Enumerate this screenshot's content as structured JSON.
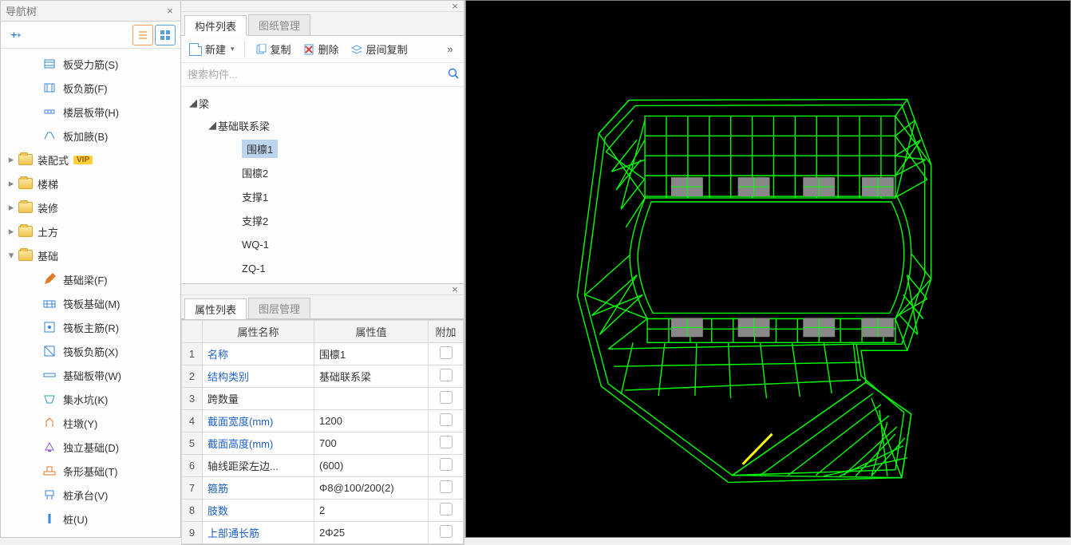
{
  "nav": {
    "title": "导航树",
    "items1": [
      {
        "icon": "slab-rebar",
        "label": "板受力筋(S)"
      },
      {
        "icon": "slab-neg",
        "label": "板负筋(F)"
      },
      {
        "icon": "floor-strip",
        "label": "楼层板带(H)"
      },
      {
        "icon": "slab-haunch",
        "label": "板加腋(B)"
      }
    ],
    "folders": [
      {
        "label": "装配式",
        "vip": true,
        "open": false
      },
      {
        "label": "楼梯",
        "open": false
      },
      {
        "label": "装修",
        "open": false
      },
      {
        "label": "土方",
        "open": false
      },
      {
        "label": "基础",
        "open": true
      }
    ],
    "items2": [
      {
        "icon": "pencil",
        "label": "基础梁(F)",
        "cls": "orange-ic"
      },
      {
        "icon": "raft",
        "label": "筏板基础(M)"
      },
      {
        "icon": "raft-main",
        "label": "筏板主筋(R)"
      },
      {
        "icon": "raft-neg",
        "label": "筏板负筋(X)"
      },
      {
        "icon": "found-strip",
        "label": "基础板带(W)"
      },
      {
        "icon": "sump",
        "label": "集水坑(K)",
        "cls": "teal-ic"
      },
      {
        "icon": "pier",
        "label": "柱墩(Y)",
        "cls": "orange-ic"
      },
      {
        "icon": "iso-footing",
        "label": "独立基础(D)",
        "cls": "purple-ic"
      },
      {
        "icon": "strip-footing",
        "label": "条形基础(T)",
        "cls": "orange-ic"
      },
      {
        "icon": "pile-cap",
        "label": "桩承台(V)"
      },
      {
        "icon": "pile",
        "label": "桩(U)"
      }
    ]
  },
  "comp": {
    "tabs": [
      "构件列表",
      "图纸管理"
    ],
    "toolbar": {
      "new": "新建",
      "copy": "复制",
      "delete": "删除",
      "floorcopy": "层间复制"
    },
    "search_placeholder": "搜索构件...",
    "tree": {
      "root": "梁",
      "group": "基础联系梁",
      "items": [
        "围檩1",
        "围檩2",
        "支撑1",
        "支撑2",
        "WQ-1",
        "ZQ-1"
      ],
      "selected": 0
    }
  },
  "prop": {
    "tabs": [
      "属性列表",
      "图层管理"
    ],
    "headers": {
      "name": "属性名称",
      "value": "属性值",
      "extra": "附加"
    },
    "rows": [
      {
        "n": "1",
        "name": "名称",
        "link": true,
        "value": "围檩1"
      },
      {
        "n": "2",
        "name": "结构类别",
        "link": true,
        "value": "基础联系梁"
      },
      {
        "n": "3",
        "name": "跨数量",
        "link": false,
        "value": ""
      },
      {
        "n": "4",
        "name": "截面宽度(mm)",
        "link": true,
        "value": "1200"
      },
      {
        "n": "5",
        "name": "截面高度(mm)",
        "link": true,
        "value": "700"
      },
      {
        "n": "6",
        "name": "轴线距梁左边...",
        "link": false,
        "value": "(600)"
      },
      {
        "n": "7",
        "name": "箍筋",
        "link": true,
        "value": "Φ8@100/200(2)"
      },
      {
        "n": "8",
        "name": "肢数",
        "link": true,
        "value": "2"
      },
      {
        "n": "9",
        "name": "上部通长筋",
        "link": true,
        "value": "2Φ25"
      }
    ]
  }
}
